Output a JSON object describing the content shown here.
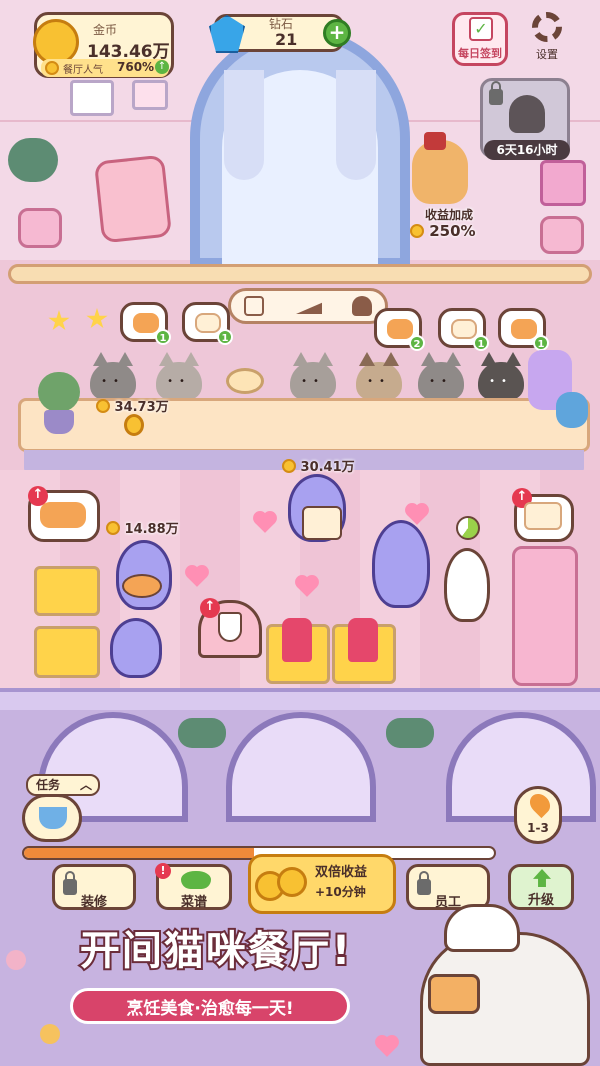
{
  "hud": {
    "gold_label": "金币",
    "gold_value": "143.46万",
    "popularity_label": "餐厅人气",
    "popularity_value": "760%",
    "gem_label": "钻石",
    "gem_value": "21",
    "daily_label": "每日签到",
    "settings_label": "设置"
  },
  "locked_area": {
    "timer": "6天16小时"
  },
  "bonus": {
    "label": "收益加成",
    "value": "250%"
  },
  "floating_money": {
    "counter": "34.73万",
    "center": "30.41万",
    "left": "14.88万"
  },
  "orders": [
    {
      "count": "1"
    },
    {
      "count": "1"
    },
    {
      "count": "2"
    },
    {
      "count": "1"
    },
    {
      "count": "1"
    }
  ],
  "task": {
    "label": "任务"
  },
  "level": {
    "label": "1-3"
  },
  "progress": {
    "fraction": 0.49
  },
  "bottom_bar": {
    "decor_label": "装修",
    "menu_label": "菜谱",
    "double_title": "双倍收益",
    "double_sub": "+10分钟",
    "staff_label": "员工",
    "upgrade_label": "升级"
  },
  "promo": {
    "title": "开间猫咪餐厅!",
    "subtitle": "烹饪美食·治愈每一天!"
  },
  "colors": {
    "accent": "#f08a3a",
    "gold": "#f8c132",
    "gem": "#38a5e8",
    "green": "#5db543",
    "alert": "#e53950"
  }
}
